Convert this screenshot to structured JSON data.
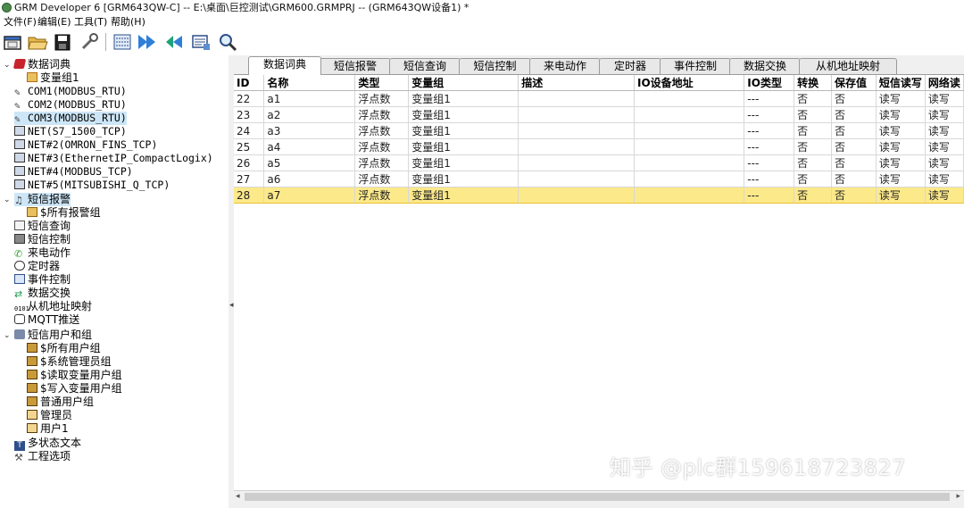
{
  "window": {
    "title": "GRM Developer 6 [GRM643QW-C]  -- E:\\桌面\\巨控测试\\GRM600.GRMPRJ -- (GRM643QW设备1) *"
  },
  "menu": {
    "file": "文件(F)",
    "edit": "编辑(E)",
    "tools": "工具(T)",
    "help": "帮助(H)"
  },
  "toolbar": {
    "icons": [
      "new-project-icon",
      "open-folder-icon",
      "save-icon",
      "tools-icon",
      "build-icon",
      "download-icon",
      "upload-icon",
      "monitor-icon",
      "search-icon"
    ]
  },
  "tree": {
    "items": [
      {
        "label": "数据词典",
        "icon": "dictionary-icon"
      },
      {
        "label": "变量组1",
        "icon": "variable-group-icon"
      },
      {
        "label": "COM1(MODBUS_RTU)",
        "icon": "serial-port-icon"
      },
      {
        "label": "COM2(MODBUS_RTU)",
        "icon": "serial-port-icon"
      },
      {
        "label": "COM3(MODBUS_RTU)",
        "icon": "serial-port-icon"
      },
      {
        "label": "NET(S7_1500_TCP)",
        "icon": "network-icon"
      },
      {
        "label": "NET#2(OMRON_FINS_TCP)",
        "icon": "network-icon"
      },
      {
        "label": "NET#3(EthernetIP_CompactLogix)",
        "icon": "network-icon"
      },
      {
        "label": "NET#4(MODBUS_TCP)",
        "icon": "network-icon"
      },
      {
        "label": "NET#5(MITSUBISHI_Q_TCP)",
        "icon": "network-icon"
      },
      {
        "label": "短信报警",
        "icon": "bell-icon"
      },
      {
        "label": "$所有报警组",
        "icon": "alarm-group-icon"
      },
      {
        "label": "短信查询",
        "icon": "sms-query-icon"
      },
      {
        "label": "短信控制",
        "icon": "sms-control-icon"
      },
      {
        "label": "来电动作",
        "icon": "phone-icon"
      },
      {
        "label": "定时器",
        "icon": "timer-icon"
      },
      {
        "label": "事件控制",
        "icon": "event-icon"
      },
      {
        "label": "数据交换",
        "icon": "exchange-icon"
      },
      {
        "label": "从机地址映射",
        "icon": "address-map-icon"
      },
      {
        "label": "MQTT推送",
        "icon": "mqtt-icon"
      },
      {
        "label": "短信用户和组",
        "icon": "users-icon"
      },
      {
        "label": "$所有用户组",
        "icon": "user-group-icon"
      },
      {
        "label": "$系统管理员组",
        "icon": "user-group-icon"
      },
      {
        "label": "$读取变量用户组",
        "icon": "user-group-icon"
      },
      {
        "label": "$写入变量用户组",
        "icon": "user-group-icon"
      },
      {
        "label": "普通用户组",
        "icon": "user-group-icon"
      },
      {
        "label": "管理员",
        "icon": "user-icon"
      },
      {
        "label": "用户1",
        "icon": "user-icon"
      },
      {
        "label": "多状态文本",
        "icon": "text-icon"
      },
      {
        "label": "工程选项",
        "icon": "wrench-icon"
      }
    ]
  },
  "tabs": [
    "数据词典",
    "短信报警",
    "短信查询",
    "短信控制",
    "来电动作",
    "定时器",
    "事件控制",
    "数据交换",
    "从机地址映射"
  ],
  "grid": {
    "columns": [
      "ID",
      "名称",
      "类型",
      "变量组",
      "描述",
      "IO设备地址",
      "IO类型",
      "转换",
      "保存值",
      "短信读写",
      "网络读"
    ],
    "rows": [
      [
        "22",
        "a1",
        "浮点数",
        "变量组1",
        "",
        "",
        "---",
        "否",
        "否",
        "读写",
        "读写"
      ],
      [
        "23",
        "a2",
        "浮点数",
        "变量组1",
        "",
        "",
        "---",
        "否",
        "否",
        "读写",
        "读写"
      ],
      [
        "24",
        "a3",
        "浮点数",
        "变量组1",
        "",
        "",
        "---",
        "否",
        "否",
        "读写",
        "读写"
      ],
      [
        "25",
        "a4",
        "浮点数",
        "变量组1",
        "",
        "",
        "---",
        "否",
        "否",
        "读写",
        "读写"
      ],
      [
        "26",
        "a5",
        "浮点数",
        "变量组1",
        "",
        "",
        "---",
        "否",
        "否",
        "读写",
        "读写"
      ],
      [
        "27",
        "a6",
        "浮点数",
        "变量组1",
        "",
        "",
        "---",
        "否",
        "否",
        "读写",
        "读写"
      ],
      [
        "28",
        "a7",
        "浮点数",
        "变量组1",
        "",
        "",
        "---",
        "否",
        "否",
        "读写",
        "读写"
      ]
    ]
  },
  "watermark": "知乎 @plc群159618723827"
}
